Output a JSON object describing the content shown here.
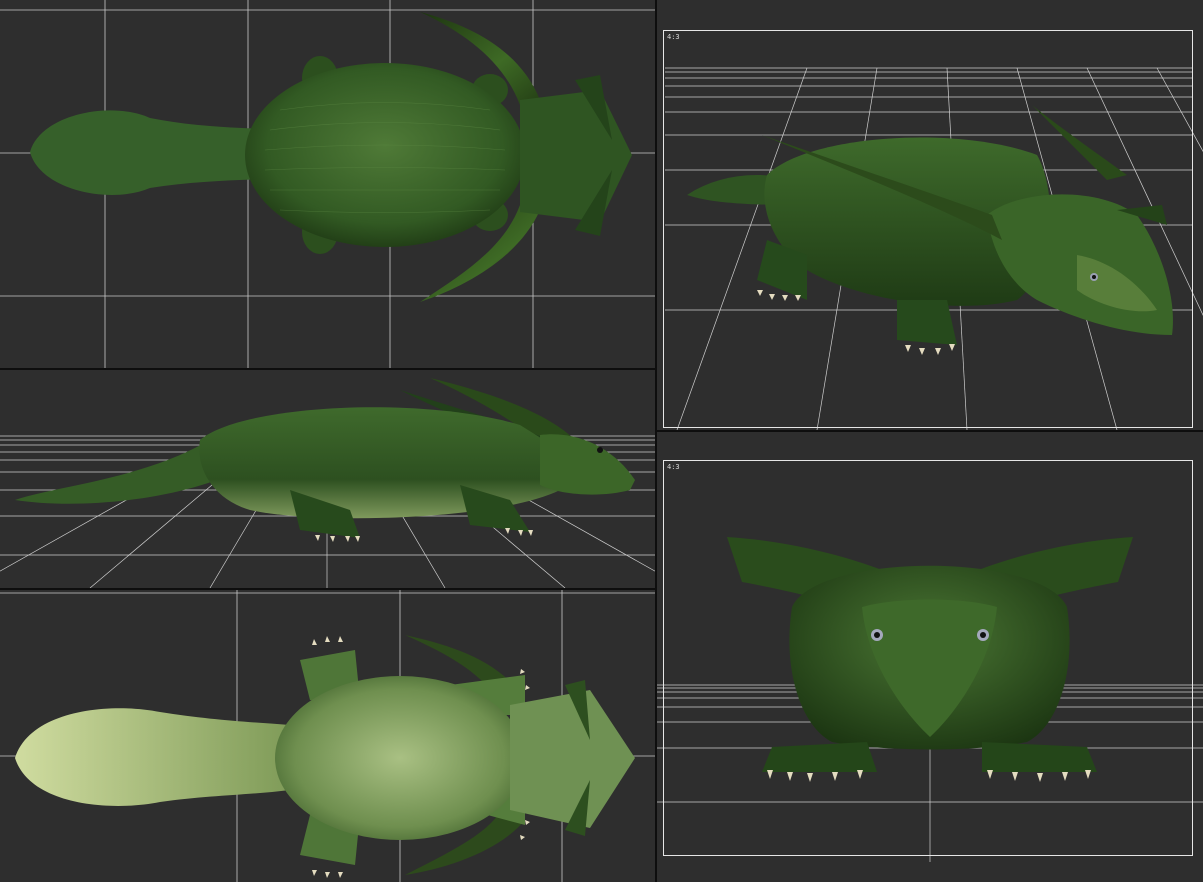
{
  "viewports": [
    {
      "name": "top",
      "label": ""
    },
    {
      "name": "side",
      "label": ""
    },
    {
      "name": "bottom",
      "label": ""
    },
    {
      "name": "perspective",
      "label": "4:3"
    },
    {
      "name": "front",
      "label": "4:3"
    }
  ],
  "colors": {
    "background": "#2e2e2e",
    "grid": "#cfcfcf",
    "frame": "#e6e6e6",
    "creature_skin": "#3f6b2c",
    "creature_dark": "#1f3a16",
    "creature_belly": "#8ea86a",
    "horn": "#2d4a1c",
    "claw": "#e4dcc0"
  },
  "icons": [
    "dragon-model-top-view",
    "dragon-model-side-view",
    "dragon-model-bottom-view",
    "dragon-model-perspective-view",
    "dragon-model-front-view"
  ]
}
